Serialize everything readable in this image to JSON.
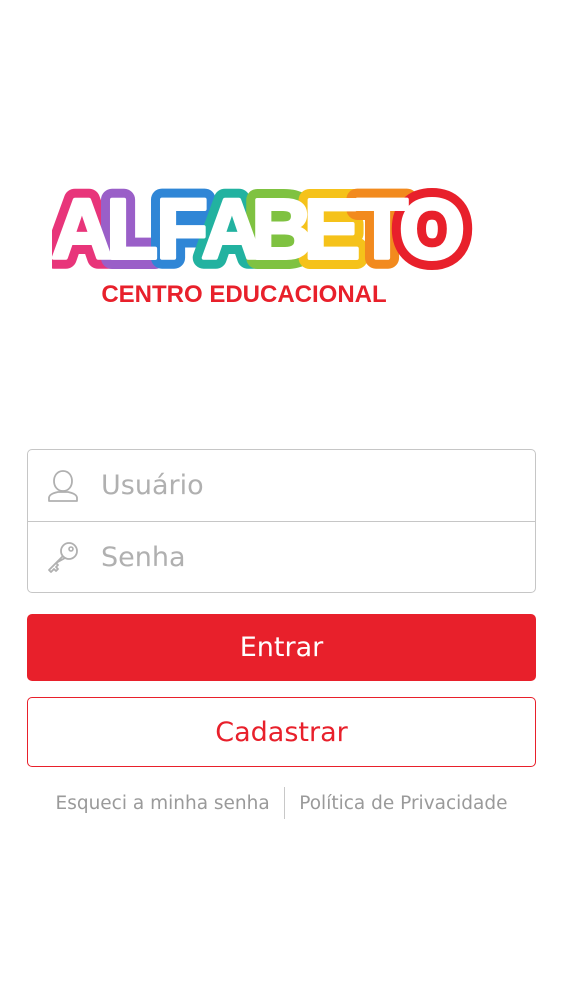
{
  "logo": {
    "title": "ALFABETO",
    "subtitle": "CENTRO EDUCACIONAL",
    "subtitle_color": "#e8202b",
    "letter_colors": [
      "#e8357a",
      "#9a5fc8",
      "#2f86d6",
      "#22b2a0",
      "#7fc241",
      "#f5c21a",
      "#f28a1e",
      "#e8202b"
    ]
  },
  "login": {
    "username": {
      "placeholder": "Usuário",
      "value": "",
      "icon": "user-icon"
    },
    "password": {
      "placeholder": "Senha",
      "value": "",
      "icon": "key-icon"
    }
  },
  "actions": {
    "login_label": "Entrar",
    "register_label": "Cadastrar"
  },
  "links": {
    "forgot_password": "Esqueci a minha senha",
    "privacy_policy": "Política de Privacidade"
  },
  "colors": {
    "accent": "#e8202b",
    "border": "#c6c6c6",
    "muted_text": "#9a9a9a"
  }
}
